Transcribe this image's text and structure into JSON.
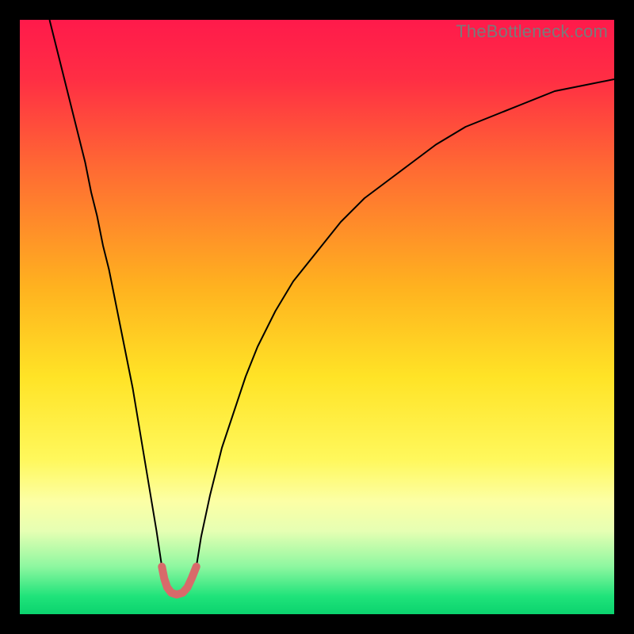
{
  "watermark": "TheBottleneck.com",
  "chart_data": {
    "type": "line",
    "title": "",
    "xlabel": "",
    "ylabel": "",
    "xlim": [
      0,
      100
    ],
    "ylim": [
      0,
      100
    ],
    "grid": false,
    "background_gradient": {
      "stops": [
        {
          "offset": 0.0,
          "color": "#ff1a4b"
        },
        {
          "offset": 0.1,
          "color": "#ff2e44"
        },
        {
          "offset": 0.25,
          "color": "#ff6a33"
        },
        {
          "offset": 0.45,
          "color": "#ffb21f"
        },
        {
          "offset": 0.6,
          "color": "#ffe326"
        },
        {
          "offset": 0.74,
          "color": "#fff85c"
        },
        {
          "offset": 0.81,
          "color": "#fcffa5"
        },
        {
          "offset": 0.86,
          "color": "#e6ffb3"
        },
        {
          "offset": 0.92,
          "color": "#8df7a0"
        },
        {
          "offset": 0.97,
          "color": "#1fe37a"
        },
        {
          "offset": 1.0,
          "color": "#0bd36e"
        }
      ]
    },
    "series": [
      {
        "name": "left-branch",
        "color": "#000000",
        "width": 2,
        "x": [
          5,
          6,
          7,
          8,
          9,
          10,
          11,
          12,
          13,
          14,
          15,
          16,
          17,
          18,
          19,
          20,
          21,
          22,
          23,
          23.9
        ],
        "y": [
          100,
          96,
          92,
          88,
          84,
          80,
          76,
          71,
          67,
          62,
          58,
          53,
          48,
          43,
          38,
          32,
          26,
          20,
          14,
          8
        ]
      },
      {
        "name": "right-branch",
        "color": "#000000",
        "width": 2,
        "x": [
          29.7,
          30.5,
          32,
          34,
          36,
          38,
          40,
          43,
          46,
          50,
          54,
          58,
          62,
          66,
          70,
          75,
          80,
          85,
          90,
          95,
          100
        ],
        "y": [
          8,
          13,
          20,
          28,
          34,
          40,
          45,
          51,
          56,
          61,
          66,
          70,
          73,
          76,
          79,
          82,
          84,
          86,
          88,
          89,
          90
        ]
      },
      {
        "name": "bottom-valley",
        "color": "#d86a6a",
        "width": 10,
        "linecap": "round",
        "x": [
          23.9,
          24.3,
          24.8,
          25.5,
          26.4,
          27.4,
          28.2,
          28.9,
          29.3,
          29.7
        ],
        "y": [
          8,
          6,
          4.5,
          3.6,
          3.3,
          3.6,
          4.5,
          6,
          7,
          8
        ]
      }
    ]
  }
}
